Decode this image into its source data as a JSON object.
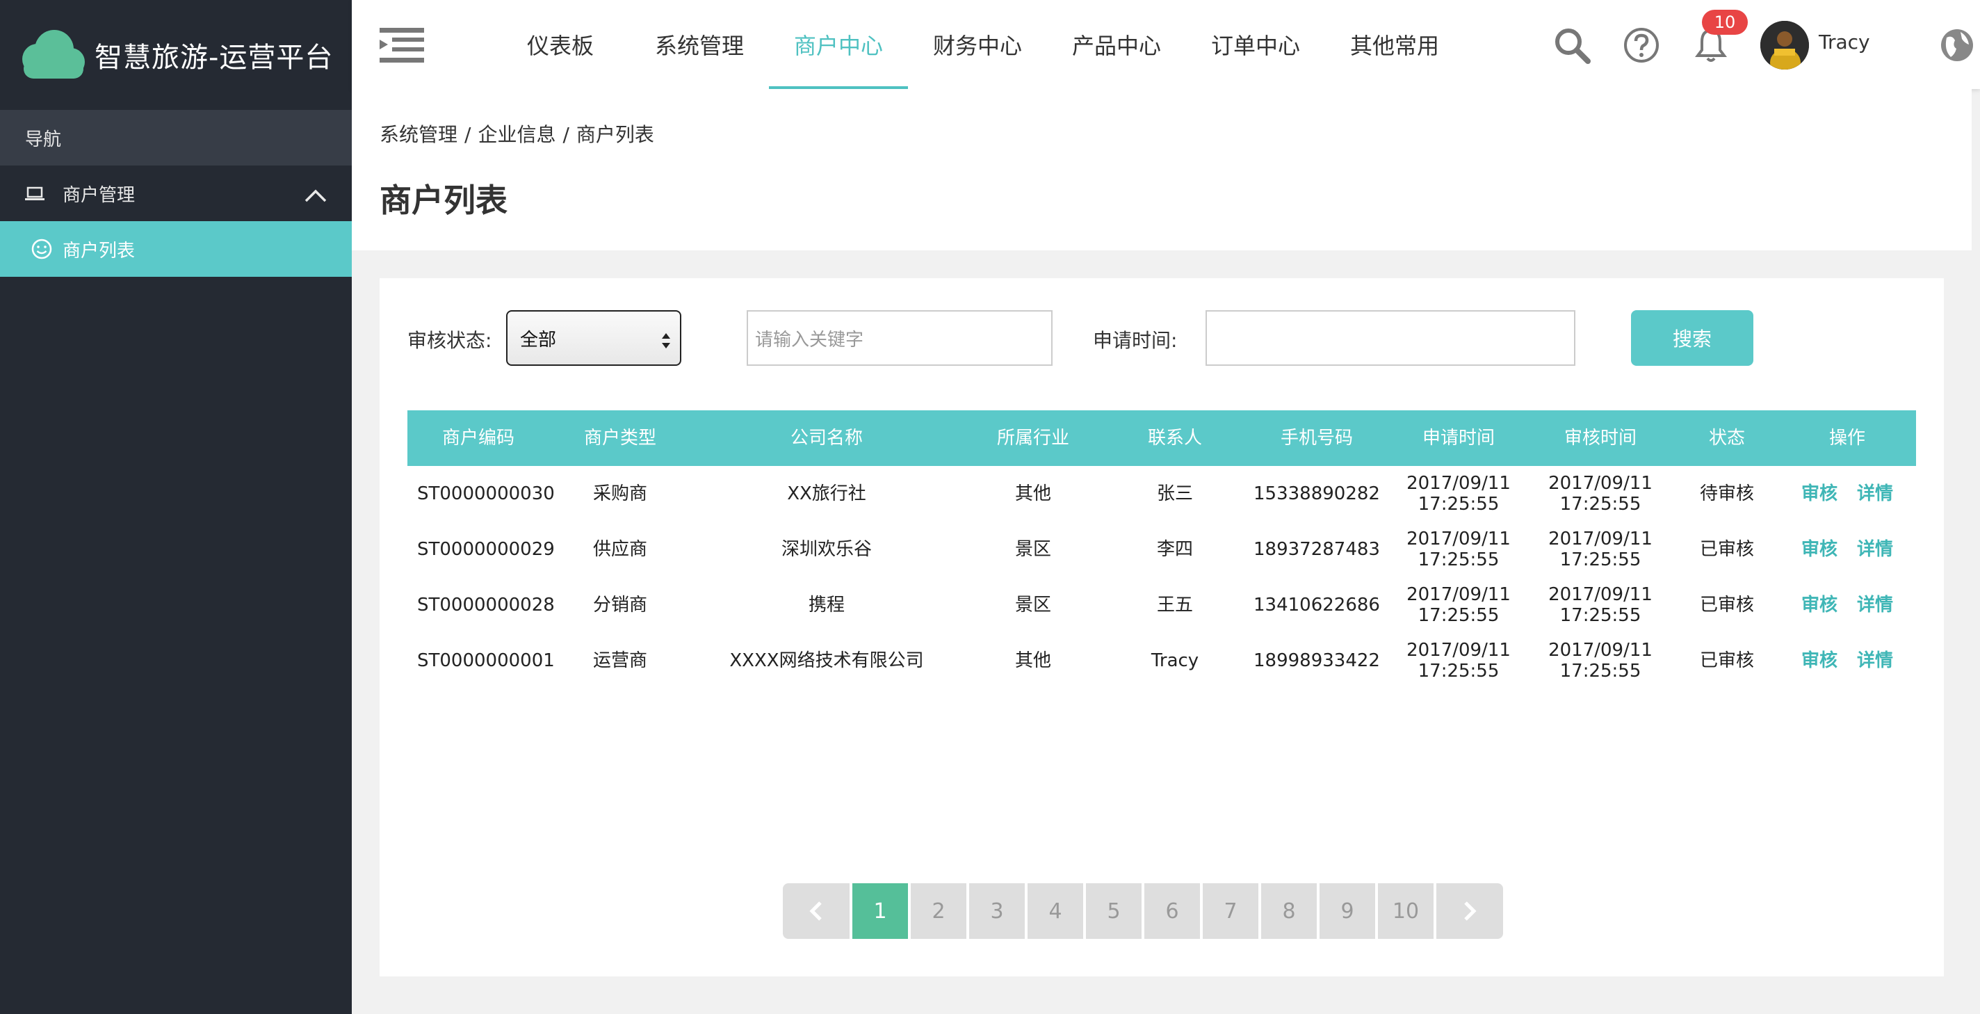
{
  "brand": {
    "title": "智慧旅游-运营平台"
  },
  "sidebar": {
    "header": "导航",
    "group_label": "商户管理",
    "active_item": "商户列表"
  },
  "topnav": {
    "tabs": [
      {
        "label": "仪表板"
      },
      {
        "label": "系统管理"
      },
      {
        "label": "商户中心"
      },
      {
        "label": "财务中心"
      },
      {
        "label": "产品中心"
      },
      {
        "label": "订单中心"
      },
      {
        "label": "其他常用"
      }
    ],
    "active_tab": "商户中心",
    "notification_count": "10",
    "username": "Tracy"
  },
  "breadcrumb": [
    "系统管理",
    "企业信息",
    "商户列表"
  ],
  "page_title": "商户列表",
  "filters": {
    "status_label": "审核状态:",
    "status_value": "全部",
    "keyword_placeholder": "请输入关键字",
    "time_label": "申请时间:",
    "time_value": "",
    "search_label": "搜索"
  },
  "table": {
    "headers": [
      "商户编码",
      "商户类型",
      "公司名称",
      "所属行业",
      "联系人",
      "手机号码",
      "申请时间",
      "审核时间",
      "状态",
      "操作"
    ],
    "action_review": "审核",
    "action_detail": "详情",
    "rows": [
      {
        "code": "ST0000000030",
        "type": "采购商",
        "company": "XX旅行社",
        "industry": "其他",
        "contact": "张三",
        "phone": "15338890282",
        "apply_date": "2017/09/11",
        "apply_time": "17:25:55",
        "review_date": "2017/09/11",
        "review_time": "17:25:55",
        "status": "待审核"
      },
      {
        "code": "ST0000000029",
        "type": "供应商",
        "company": "深圳欢乐谷",
        "industry": "景区",
        "contact": "李四",
        "phone": "18937287483",
        "apply_date": "2017/09/11",
        "apply_time": "17:25:55",
        "review_date": "2017/09/11",
        "review_time": "17:25:55",
        "status": "已审核"
      },
      {
        "code": "ST0000000028",
        "type": "分销商",
        "company": "携程",
        "industry": "景区",
        "contact": "王五",
        "phone": "13410622686",
        "apply_date": "2017/09/11",
        "apply_time": "17:25:55",
        "review_date": "2017/09/11",
        "review_time": "17:25:55",
        "status": "已审核"
      },
      {
        "code": "ST0000000001",
        "type": "运营商",
        "company": "XXXX网络技术有限公司",
        "industry": "其他",
        "contact": "Tracy",
        "phone": "18998933422",
        "apply_date": "2017/09/11",
        "apply_time": "17:25:55",
        "review_date": "2017/09/11",
        "review_time": "17:25:55",
        "status": "已审核"
      }
    ]
  },
  "pagination": {
    "pages": [
      "1",
      "2",
      "3",
      "4",
      "5",
      "6",
      "7",
      "8",
      "9",
      "10"
    ],
    "current": "1"
  },
  "colors": {
    "accent": "#5bc9c9",
    "sidebar": "#252a33",
    "badge": "#e84545",
    "page_active": "#55bf99"
  }
}
